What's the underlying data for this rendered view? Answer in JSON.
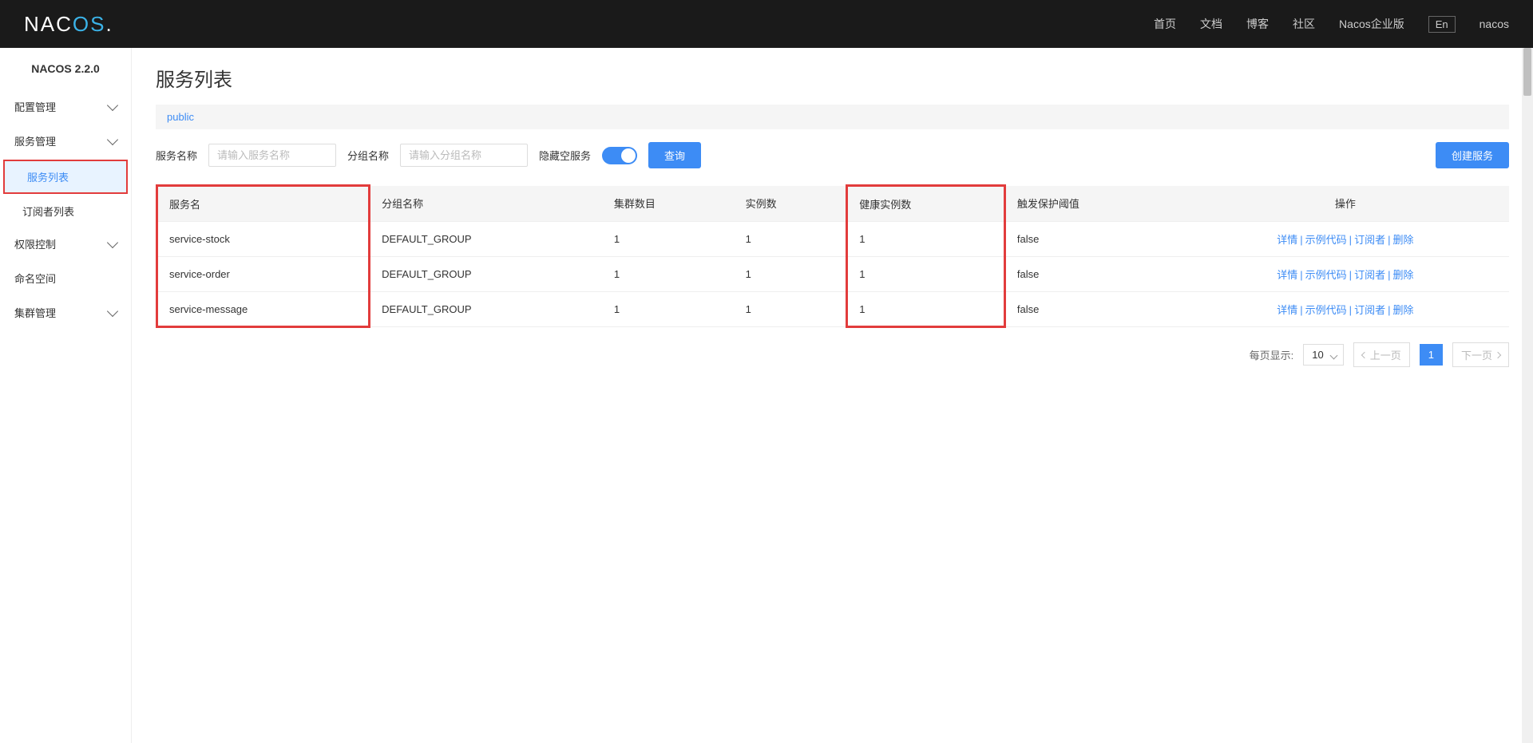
{
  "header": {
    "logo_main": "NAC",
    "logo_accent": "OS",
    "logo_dot": ".",
    "nav": [
      "首页",
      "文档",
      "博客",
      "社区",
      "Nacos企业版"
    ],
    "lang": "En",
    "user": "nacos"
  },
  "sidebar": {
    "version": "NACOS 2.2.0",
    "items": [
      {
        "label": "配置管理",
        "expandable": true
      },
      {
        "label": "服务管理",
        "expandable": true,
        "children": [
          {
            "label": "服务列表",
            "active": true
          },
          {
            "label": "订阅者列表",
            "active": false
          }
        ]
      },
      {
        "label": "权限控制",
        "expandable": true
      },
      {
        "label": "命名空间",
        "expandable": false
      },
      {
        "label": "集群管理",
        "expandable": true
      }
    ]
  },
  "page": {
    "title": "服务列表",
    "namespace": "public",
    "search": {
      "service_label": "服务名称",
      "service_placeholder": "请输入服务名称",
      "group_label": "分组名称",
      "group_placeholder": "请输入分组名称",
      "hide_empty_label": "隐藏空服务",
      "query_btn": "查询",
      "create_btn": "创建服务"
    },
    "table": {
      "headers": [
        "服务名",
        "分组名称",
        "集群数目",
        "实例数",
        "健康实例数",
        "触发保护阈值",
        "操作"
      ],
      "rows": [
        {
          "service": "service-stock",
          "group": "DEFAULT_GROUP",
          "clusters": "1",
          "instances": "1",
          "healthy": "1",
          "threshold": "false"
        },
        {
          "service": "service-order",
          "group": "DEFAULT_GROUP",
          "clusters": "1",
          "instances": "1",
          "healthy": "1",
          "threshold": "false"
        },
        {
          "service": "service-message",
          "group": "DEFAULT_GROUP",
          "clusters": "1",
          "instances": "1",
          "healthy": "1",
          "threshold": "false"
        }
      ],
      "actions": [
        "详情",
        "示例代码",
        "订阅者",
        "删除"
      ]
    },
    "pagination": {
      "page_size_label": "每页显示:",
      "page_size": "10",
      "prev": "上一页",
      "current": "1",
      "next": "下一页"
    }
  }
}
